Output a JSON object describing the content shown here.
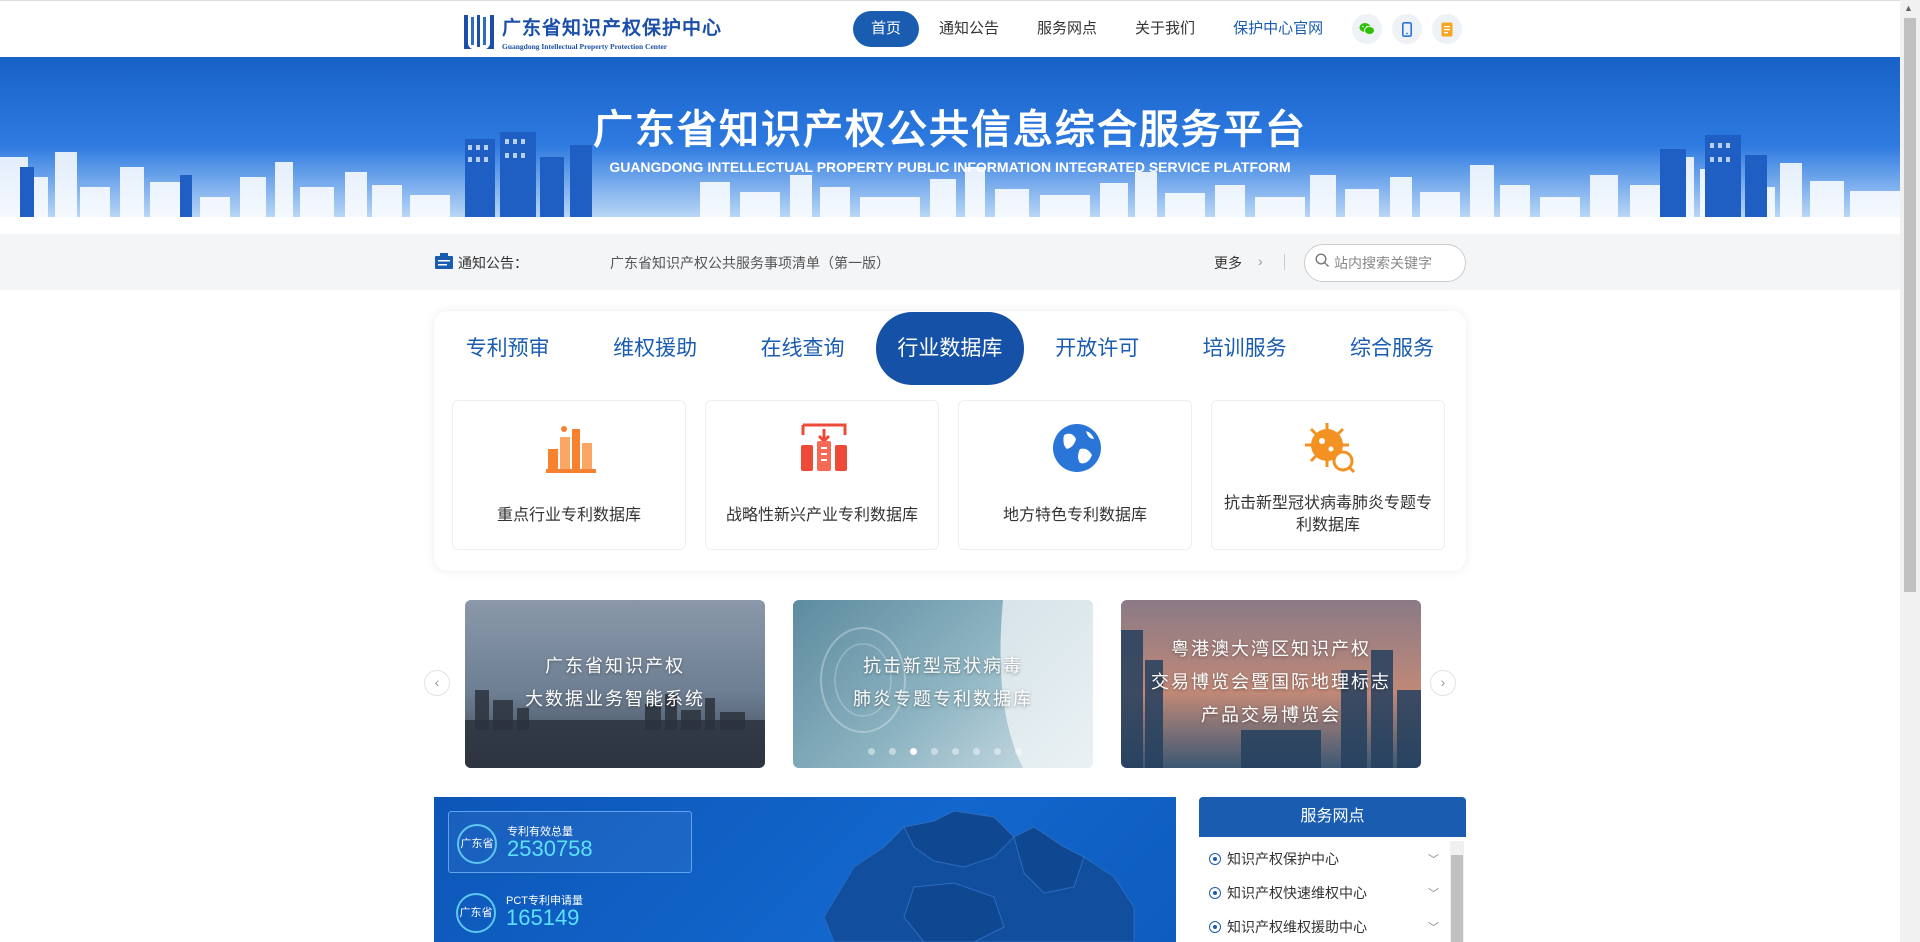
{
  "header": {
    "logo_cn": "广东省知识产权保护中心",
    "logo_en": "Guangdong Intellectual Property Protection Center",
    "nav": [
      {
        "label": "首页"
      },
      {
        "label": "通知公告"
      },
      {
        "label": "服务网点"
      },
      {
        "label": "关于我们"
      },
      {
        "label": "保护中心官网"
      }
    ],
    "icons": [
      "wechat-icon",
      "mobile-icon",
      "notebook-icon"
    ]
  },
  "banner": {
    "title": "广东省知识产权公共信息综合服务平台",
    "subtitle": "GUANGDONG INTELLECTUAL PROPERTY PUBLIC INFORMATION INTEGRATED SERVICE PLATFORM"
  },
  "notice": {
    "label": "通知公告：",
    "text": "广东省知识产权公共服务事项清单（第一版）",
    "more": "更多",
    "search_placeholder": "站内搜索关键字"
  },
  "tabs": [
    {
      "label": "专利预审"
    },
    {
      "label": "维权援助"
    },
    {
      "label": "在线查询"
    },
    {
      "label": "行业数据库",
      "active": true
    },
    {
      "label": "开放许可"
    },
    {
      "label": "培训服务"
    },
    {
      "label": "综合服务"
    }
  ],
  "cards": [
    {
      "label": "重点行业专利数据库",
      "icon": "industry-icon",
      "color": "#f7812f"
    },
    {
      "label": "战略性新兴产业专利数据库",
      "icon": "emerging-industry-icon",
      "color": "#ee4a39"
    },
    {
      "label": "地方特色专利数据库",
      "icon": "globe-icon",
      "color": "#2a76d8"
    },
    {
      "label": "抗击新型冠状病毒肺炎专题专利数据库",
      "icon": "virus-search-icon",
      "color": "#f39222"
    }
  ],
  "carousel": {
    "slides": [
      {
        "line1": "广东省知识产权",
        "line2": "大数据业务智能系统"
      },
      {
        "line1": "抗击新型冠状病毒",
        "line2": "肺炎专题专利数据库"
      },
      {
        "line1": "粤港澳大湾区知识产权",
        "line2": "交易博览会暨国际地理标志",
        "line3": "产品交易博览会"
      }
    ],
    "dot_count": 8,
    "active_dot": 2
  },
  "stats": [
    {
      "badge": "广东省",
      "label": "专利有效总量",
      "value": "2530758"
    },
    {
      "badge": "广东省",
      "label": "PCT专利申请量",
      "value": "165149"
    }
  ],
  "service_points": {
    "title": "服务网点",
    "items": [
      {
        "label": "知识产权保护中心"
      },
      {
        "label": "知识产权快速维权中心"
      },
      {
        "label": "知识产权维权援助中心"
      }
    ]
  },
  "colors": {
    "primary": "#1a5db0",
    "tab_active": "#1551a6",
    "stat_value": "#5ee0ff"
  }
}
